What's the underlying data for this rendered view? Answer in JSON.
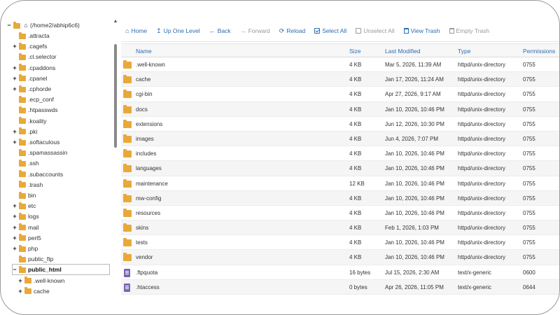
{
  "sidebar": {
    "root_label": "(/home2/abhip6c6)",
    "items": [
      {
        "label": ".attracta",
        "toggle": ""
      },
      {
        "label": ".cagefs",
        "toggle": "+"
      },
      {
        "label": ".cl.selector",
        "toggle": ""
      },
      {
        "label": ".cpaddons",
        "toggle": "+"
      },
      {
        "label": ".cpanel",
        "toggle": "+"
      },
      {
        "label": ".cphorde",
        "toggle": "+"
      },
      {
        "label": ".ecp_conf",
        "toggle": ""
      },
      {
        "label": ".htpasswds",
        "toggle": ""
      },
      {
        "label": ".koality",
        "toggle": ""
      },
      {
        "label": ".pki",
        "toggle": "+"
      },
      {
        "label": ".softaculous",
        "toggle": "+"
      },
      {
        "label": ".spamassassin",
        "toggle": ""
      },
      {
        "label": ".ssh",
        "toggle": ""
      },
      {
        "label": ".subaccounts",
        "toggle": ""
      },
      {
        "label": ".trash",
        "toggle": ""
      },
      {
        "label": "bin",
        "toggle": ""
      },
      {
        "label": "etc",
        "toggle": "+"
      },
      {
        "label": "logs",
        "toggle": "+"
      },
      {
        "label": "mail",
        "toggle": "+"
      },
      {
        "label": "perl5",
        "toggle": "+"
      },
      {
        "label": "php",
        "toggle": "+"
      },
      {
        "label": "public_ftp",
        "toggle": ""
      },
      {
        "label": "public_html",
        "toggle": "−"
      }
    ],
    "children": [
      {
        "label": ".well-known",
        "toggle": "+"
      },
      {
        "label": "cache",
        "toggle": "+"
      }
    ]
  },
  "toolbar": {
    "home": "Home",
    "up_one_level": "Up One Level",
    "back": "Back",
    "forward": "Forward",
    "reload": "Reload",
    "select_all": "Select All",
    "unselect_all": "Unselect All",
    "view_trash": "View Trash",
    "empty_trash": "Empty Trash"
  },
  "table": {
    "headers": {
      "name": "Name",
      "size": "Size",
      "modified": "Last Modified",
      "type": "Type",
      "permissions": "Permissions"
    },
    "rows": [
      {
        "icon": "folder",
        "name": ".well-known",
        "size": "4 KB",
        "modified": "Mar 5, 2026, 11:39 AM",
        "type": "httpd/unix-directory",
        "perm": "0755"
      },
      {
        "icon": "folder",
        "name": "cache",
        "size": "4 KB",
        "modified": "Jan 17, 2026, 11:24 AM",
        "type": "httpd/unix-directory",
        "perm": "0755"
      },
      {
        "icon": "folder",
        "name": "cgi-bin",
        "size": "4 KB",
        "modified": "Apr 27, 2026, 9:17 AM",
        "type": "httpd/unix-directory",
        "perm": "0755"
      },
      {
        "icon": "folder",
        "name": "docs",
        "size": "4 KB",
        "modified": "Jan 10, 2026, 10:46 PM",
        "type": "httpd/unix-directory",
        "perm": "0755"
      },
      {
        "icon": "folder",
        "name": "extensions",
        "size": "4 KB",
        "modified": "Jun 12, 2026, 10:30 PM",
        "type": "httpd/unix-directory",
        "perm": "0755"
      },
      {
        "icon": "folder",
        "name": "images",
        "size": "4 KB",
        "modified": "Jun 4, 2026, 7:07 PM",
        "type": "httpd/unix-directory",
        "perm": "0755"
      },
      {
        "icon": "folder",
        "name": "includes",
        "size": "4 KB",
        "modified": "Jan 10, 2026, 10:46 PM",
        "type": "httpd/unix-directory",
        "perm": "0755"
      },
      {
        "icon": "folder",
        "name": "languages",
        "size": "4 KB",
        "modified": "Jan 10, 2026, 10:46 PM",
        "type": "httpd/unix-directory",
        "perm": "0755"
      },
      {
        "icon": "folder",
        "name": "maintenance",
        "size": "12 KB",
        "modified": "Jan 10, 2026, 10:46 PM",
        "type": "httpd/unix-directory",
        "perm": "0755"
      },
      {
        "icon": "folder",
        "name": "mw-config",
        "size": "4 KB",
        "modified": "Jan 10, 2026, 10:46 PM",
        "type": "httpd/unix-directory",
        "perm": "0755"
      },
      {
        "icon": "folder",
        "name": "resources",
        "size": "4 KB",
        "modified": "Jan 10, 2026, 10:46 PM",
        "type": "httpd/unix-directory",
        "perm": "0755"
      },
      {
        "icon": "folder",
        "name": "skins",
        "size": "4 KB",
        "modified": "Feb 1, 2026, 1:03 PM",
        "type": "httpd/unix-directory",
        "perm": "0755"
      },
      {
        "icon": "folder",
        "name": "tests",
        "size": "4 KB",
        "modified": "Jan 10, 2026, 10:46 PM",
        "type": "httpd/unix-directory",
        "perm": "0755"
      },
      {
        "icon": "folder",
        "name": "vendor",
        "size": "4 KB",
        "modified": "Jan 10, 2026, 10:46 PM",
        "type": "httpd/unix-directory",
        "perm": "0755"
      },
      {
        "icon": "file",
        "name": ".ftpquota",
        "size": "16 bytes",
        "modified": "Jul 15, 2026, 2:30 AM",
        "type": "text/x-generic",
        "perm": "0600"
      },
      {
        "icon": "file",
        "name": ".htaccess",
        "size": "0 bytes",
        "modified": "Apr 26, 2026, 11:05 PM",
        "type": "text/x-generic",
        "perm": "0644"
      }
    ]
  },
  "colors": {
    "link_blue": "#2a6db0",
    "folder": "#e8a93a",
    "file": "#7a66b3",
    "disabled": "#9a9a9a"
  }
}
